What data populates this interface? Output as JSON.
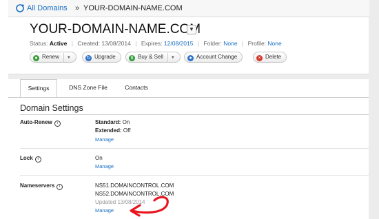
{
  "breadcrumb": {
    "link": "All Domains",
    "separator": "»",
    "current": "YOUR-DOMAIN-NAME.COM"
  },
  "domain": {
    "name": "YOUR-DOMAIN-NAME.COM",
    "status_label": "Status:",
    "status_value": "Active",
    "created_label": "Created:",
    "created_value": "13/08/2014",
    "expires_label": "Expires:",
    "expires_value": "12/08/2015",
    "folder_label": "Folder:",
    "folder_value": "None",
    "profile_label": "Profile:",
    "profile_value": "None"
  },
  "actions": {
    "renew": "Renew",
    "upgrade": "Upgrade",
    "buy_sell": "Buy & Sell",
    "account_change": "Account Change",
    "delete": "Delete"
  },
  "tabs": [
    "Settings",
    "DNS Zone File",
    "Contacts"
  ],
  "section": {
    "title": "Domain Settings",
    "auto_renew": {
      "label": "Auto-Renew",
      "standard_label": "Standard:",
      "standard_value": "On",
      "extended_label": "Extended:",
      "extended_value": "Off",
      "manage": "Manage"
    },
    "lock": {
      "label": "Lock",
      "value": "On",
      "manage": "Manage"
    },
    "nameservers": {
      "label": "Nameservers",
      "ns1": "NS51.DOMAINCONTROL.COM",
      "ns2": "NS52.DOMAINCONTROL.COM",
      "updated": "Updated 13/08/2014",
      "manage": "Manage"
    }
  },
  "colors": {
    "link": "#1a6fc4",
    "annotation_arrow": "#e8141e"
  },
  "icons": {
    "home": "refresh-home-icon",
    "info": "info-icon",
    "dropdown": "chevron-down-icon"
  }
}
